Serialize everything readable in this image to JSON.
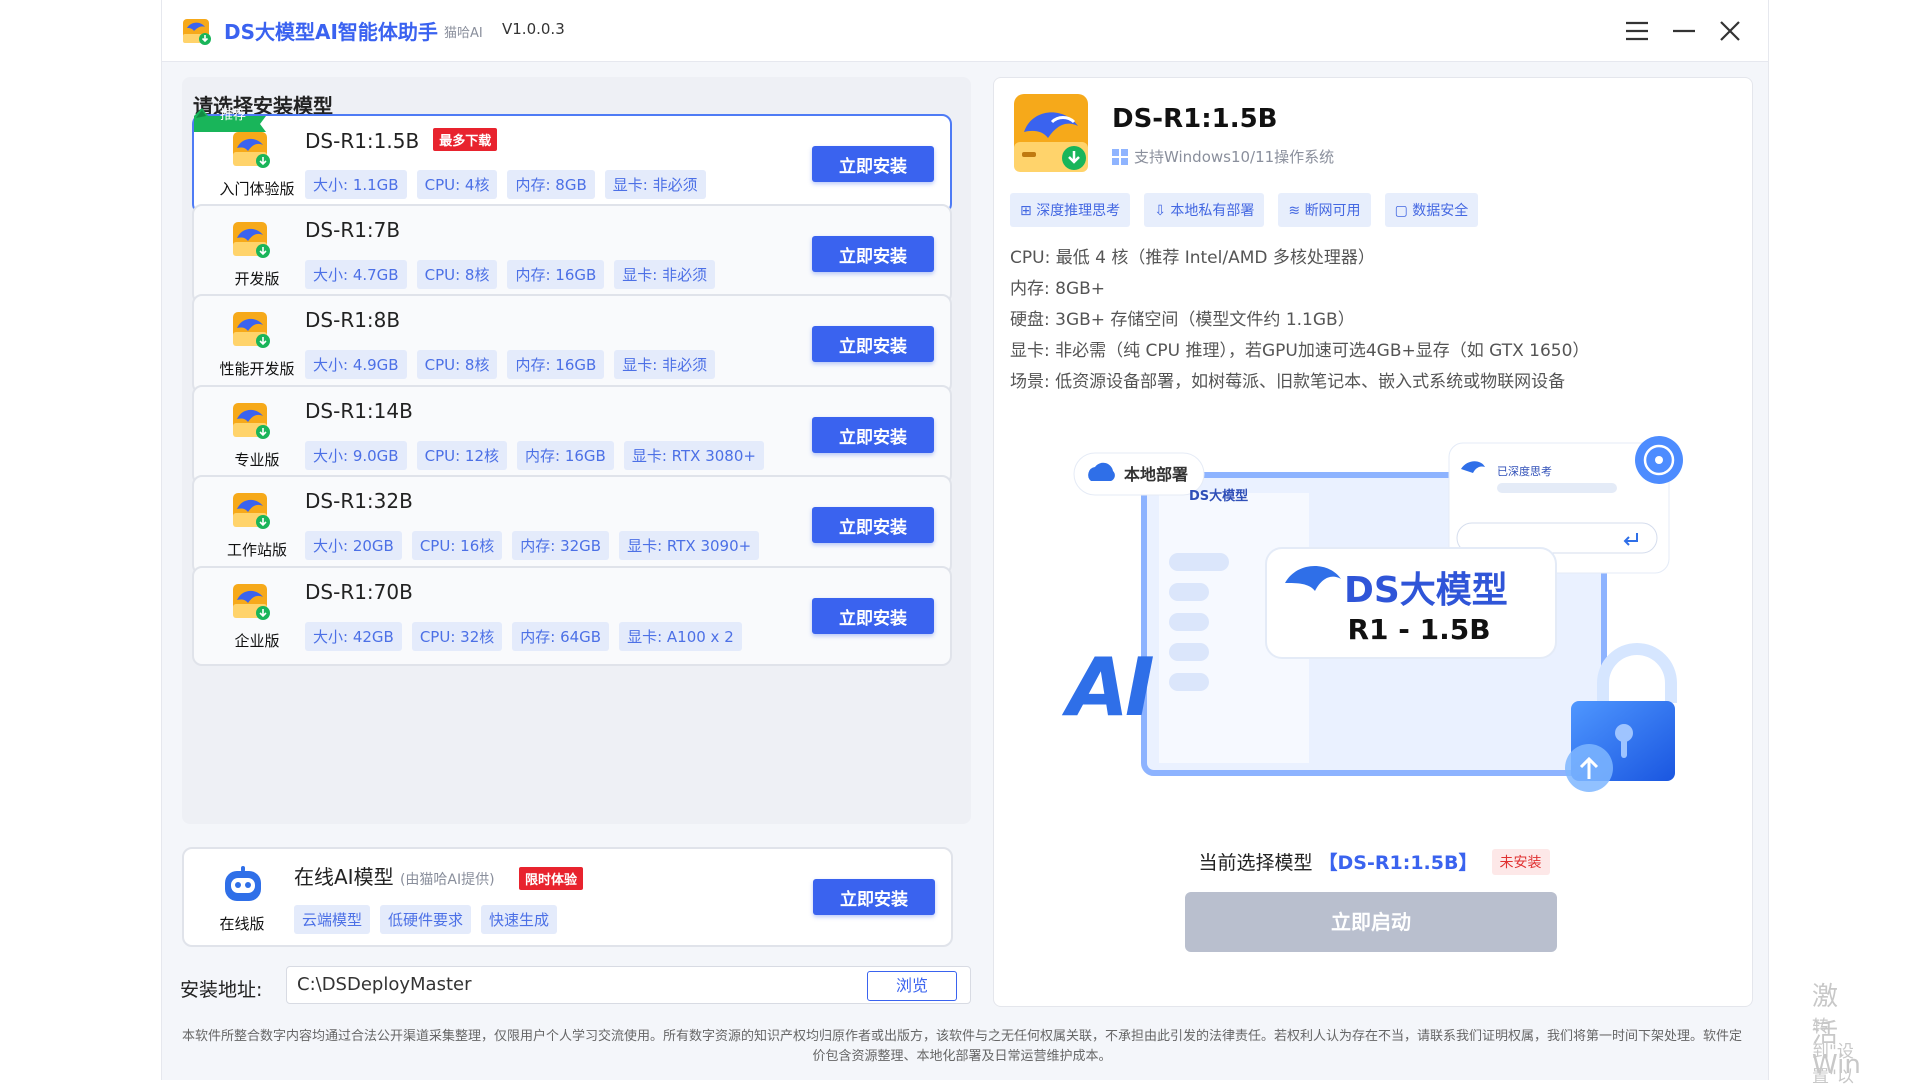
{
  "titlebar": {
    "title": "DS大模型AI智能体助手",
    "sub": "猫哈AI",
    "version": "V1.0.0.3"
  },
  "panel_title": "请选择安装模型",
  "recommend_label": "推荐",
  "install_label": "立即安装",
  "models": [
    {
      "name": "DS-R1:1.5B",
      "edition": "入门体验版",
      "badge": "最多下载",
      "tags": [
        "大小: 1.1GB",
        "CPU: 4核",
        "内存: 8GB",
        "显卡: 非必须"
      ]
    },
    {
      "name": "DS-R1:7B",
      "edition": "开发版",
      "tags": [
        "大小: 4.7GB",
        "CPU: 8核",
        "内存: 16GB",
        "显卡: 非必须"
      ]
    },
    {
      "name": "DS-R1:8B",
      "edition": "性能开发版",
      "tags": [
        "大小: 4.9GB",
        "CPU: 8核",
        "内存: 16GB",
        "显卡: 非必须"
      ]
    },
    {
      "name": "DS-R1:14B",
      "edition": "专业版",
      "tags": [
        "大小: 9.0GB",
        "CPU: 12核",
        "内存: 16GB",
        "显卡: RTX 3080+"
      ]
    },
    {
      "name": "DS-R1:32B",
      "edition": "工作站版",
      "tags": [
        "大小: 20GB",
        "CPU: 16核",
        "内存: 32GB",
        "显卡: RTX 3090+"
      ]
    },
    {
      "name": "DS-R1:70B",
      "edition": "企业版",
      "tags": [
        "大小: 42GB",
        "CPU: 32核",
        "内存: 64GB",
        "显卡: A100 x 2"
      ]
    }
  ],
  "online": {
    "name": "在线AI模型",
    "provider": "(由猫哈AI提供)",
    "badge": "限时体验",
    "edition": "在线版",
    "tags": [
      "云端模型",
      "低硬件要求",
      "快速生成"
    ]
  },
  "install_path": {
    "label": "安装地址:",
    "value": "C:\\DSDeployMaster",
    "browse": "浏览"
  },
  "footer": "本软件所整合数字内容均通过合法公开渠道采集整理，仅限用户个人学习交流使用。所有数字资源的知识产权均归原作者或出版方，该软件与之无任何权属关联，不承担由此引发的法律责任。若权利人认为存在不当，请联系我们证明权属，我们将第一时间下架处理。软件定价包含资源整理、本地化部署及日常运营维护成本。",
  "detail": {
    "name": "DS-R1:1.5B",
    "os": "支持Windows10/11操作系统",
    "features": [
      "深度推理思考",
      "本地私有部署",
      "断网可用",
      "数据安全"
    ],
    "specs": [
      "CPU: 最低 4 核（推荐 Intel/AMD 多核处理器）",
      "内存: 8GB+",
      "硬盘: 3GB+ 存储空间（模型文件约 1.1GB）",
      "显卡: 非必需（纯 CPU 推理），若GPU加速可选4GB+显存（如 GTX 1650）",
      "场景: 低资源设备部署，如树莓派、旧款笔记本、嵌入式系统或物联网设备"
    ],
    "illus": {
      "local": "本地部署",
      "brand_small": "DS大模型",
      "thinking": "已深度思考",
      "brand_big": "DS大模型",
      "model": "R1 - 1.5B",
      "ai": "AI"
    },
    "current_prefix": "当前选择模型",
    "current_model": "【DS-R1:1.5B】",
    "status": "未安装",
    "launch": "立即启动"
  },
  "watermark": {
    "line1": "激活 Win",
    "line2": "转到\"设置\"以"
  },
  "colors": {
    "accent": "#3a63ef",
    "badge_red": "#e8232e",
    "disabled": "#b9bfce"
  }
}
